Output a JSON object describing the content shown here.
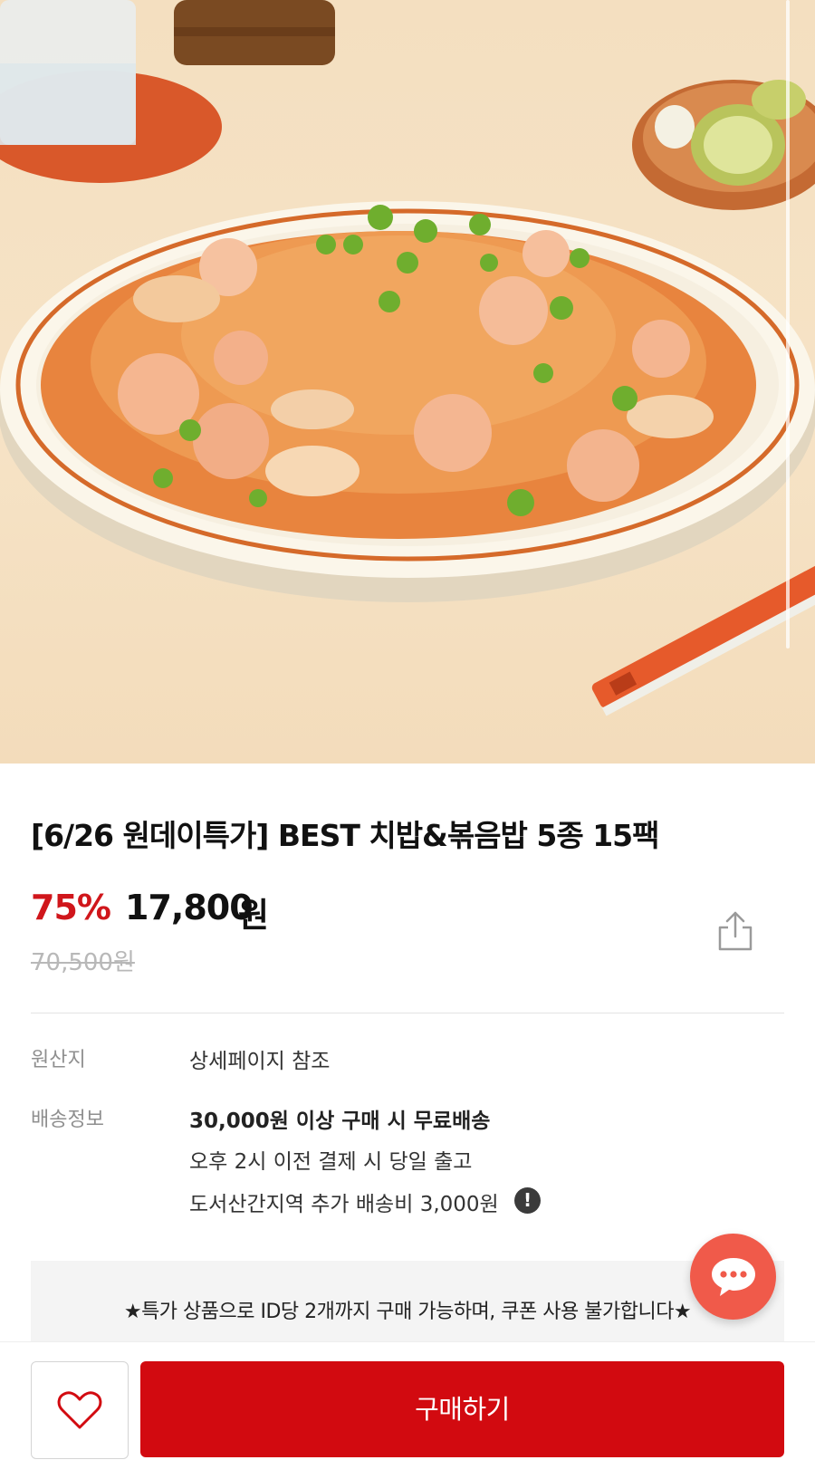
{
  "product": {
    "title": "[6/26 원데이특가] BEST 치밥&볶음밥 5종 15팩",
    "discount": "75%",
    "price": "17,800",
    "price_unit": "원",
    "original_price": "70,500원"
  },
  "info": {
    "origin_label": "원산지",
    "origin_value": "상세페이지 참조",
    "shipping_label": "배송정보",
    "shipping_lines": [
      "30,000원 이상 구매 시 무료배송",
      "오후 2시 이전 결제 시 당일 출고",
      "도서산간지역 추가 배송비 3,000원"
    ],
    "alert_glyph": "!"
  },
  "notice": "★특가 상품으로 ID당 2개까지 구매 가능하며, 쿠폰 사용 불가합니다★",
  "bottom_bar": {
    "buy_label": "구매하기"
  },
  "icons": {
    "share": "share-icon",
    "chat": "chat-bubble-icon",
    "wish": "heart-outline-icon",
    "alert": "exclamation-circle-icon"
  },
  "colors": {
    "accent_red": "#d20a10",
    "discount_red": "#d0161b",
    "chat_fab": "#f05a4a"
  }
}
